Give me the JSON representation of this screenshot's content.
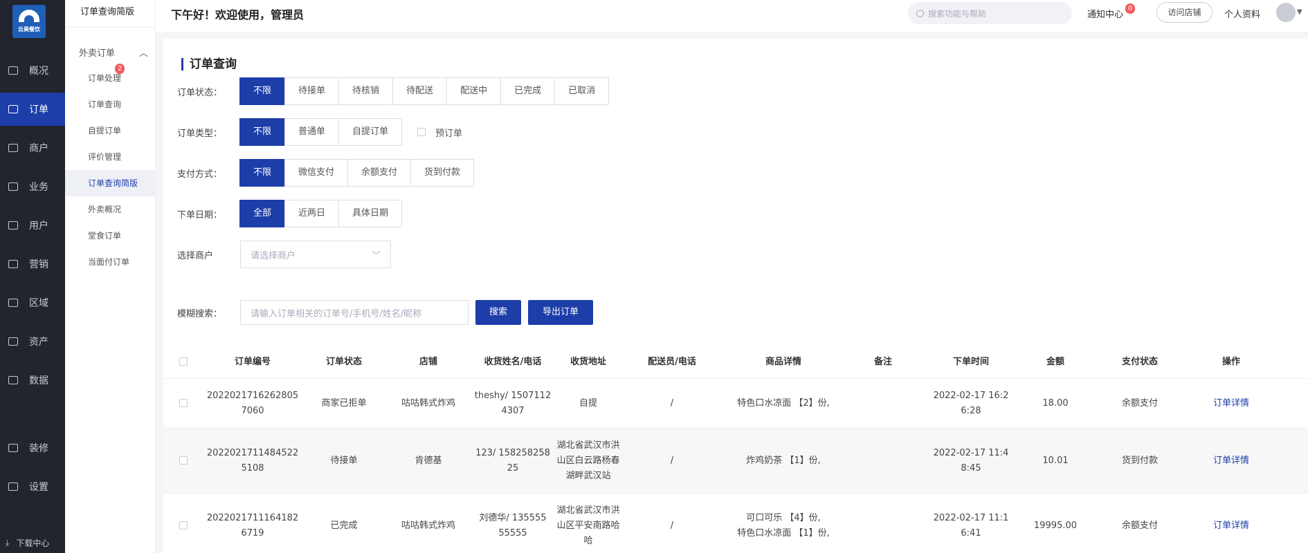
{
  "brand": {
    "logo_text": "云昊餐饮"
  },
  "nav": {
    "items": [
      {
        "label": "概况"
      },
      {
        "label": "订单"
      },
      {
        "label": "商户"
      },
      {
        "label": "业务"
      },
      {
        "label": "用户"
      },
      {
        "label": "营销"
      },
      {
        "label": "区域"
      },
      {
        "label": "资产"
      },
      {
        "label": "数据"
      },
      {
        "label": "装修"
      },
      {
        "label": "设置"
      }
    ],
    "download": "下载中心"
  },
  "subnav": {
    "title": "订单查询简版",
    "group": "外卖订单",
    "badge": "2",
    "items": [
      {
        "label": "订单处理"
      },
      {
        "label": "订单查询"
      },
      {
        "label": "自提订单"
      },
      {
        "label": "评价管理"
      },
      {
        "label": "订单查询简版"
      },
      {
        "label": "外卖概况"
      },
      {
        "label": "堂食订单"
      },
      {
        "label": "当面付订单"
      }
    ]
  },
  "header": {
    "greeting": "下午好！欢迎使用，管理员",
    "search_placeholder": "搜索功能与帮助",
    "notify": "通知中心",
    "notify_count": "0",
    "visit": "访问店铺",
    "profile": "个人资料"
  },
  "filters": {
    "title": "订单查询",
    "status": {
      "label": "订单状态：",
      "options": [
        "不限",
        "待接单",
        "待核销",
        "待配送",
        "配送中",
        "已完成",
        "已取消"
      ]
    },
    "type": {
      "label": "订单类型：",
      "options": [
        "不限",
        "普通单",
        "自提订单"
      ],
      "preorder": "预订单"
    },
    "pay": {
      "label": "支付方式：",
      "options": [
        "不限",
        "微信支付",
        "余额支付",
        "货到付款"
      ]
    },
    "date": {
      "label": "下单日期：",
      "options": [
        "全部",
        "近两日",
        "具体日期"
      ]
    },
    "merchant": {
      "label": "选择商户",
      "placeholder": "请选择商户"
    },
    "fuzzy": {
      "label": "模糊搜索：",
      "placeholder": "请输入订单相关的订单号/手机号/姓名/昵称",
      "search": "搜索",
      "export": "导出订单"
    }
  },
  "table": {
    "headers": [
      "订单编号",
      "订单状态",
      "店铺",
      "收货姓名/电话",
      "收货地址",
      "配送员/电话",
      "商品详情",
      "备注",
      "下单时间",
      "金额",
      "支付状态",
      "操作"
    ],
    "rows": [
      {
        "id1": "2022021716262805",
        "id2": "7060",
        "status": "商家已拒单",
        "shop": "咕咕韩式炸鸡",
        "contact1": "theshy/ 1507112",
        "contact2": "4307",
        "addr1": "自提",
        "addr2": "",
        "addr3": "",
        "courier": "/",
        "goods1": "特色口水凉面 【2】份,",
        "goods2": "",
        "note": "",
        "time1": "2022-02-17 16:2",
        "time2": "6:28",
        "amount": "18.00",
        "pay": "余额支付",
        "action": "订单详情"
      },
      {
        "id1": "2022021711484522",
        "id2": "5108",
        "status": "待接单",
        "shop": "肯德基",
        "contact1": "123/ 158258258",
        "contact2": "25",
        "addr1": "湖北省武汉市洪",
        "addr2": "山区白云路杨春",
        "addr3": "湖畔武汉站",
        "courier": "/",
        "goods1": "炸鸡奶茶 【1】份,",
        "goods2": "",
        "note": "",
        "time1": "2022-02-17 11:4",
        "time2": "8:45",
        "amount": "10.01",
        "pay": "货到付款",
        "action": "订单详情"
      },
      {
        "id1": "2022021711164182",
        "id2": "6719",
        "status": "已完成",
        "shop": "咕咕韩式炸鸡",
        "contact1": "刘德华/ 135555",
        "contact2": "55555",
        "addr1": "湖北省武汉市洪",
        "addr2": "山区平安南路哈",
        "addr3": "哈",
        "courier": "/",
        "goods1": "可口可乐 【4】份,",
        "goods2": "特色口水凉面 【1】份,",
        "note": "",
        "time1": "2022-02-17 11:1",
        "time2": "6:41",
        "amount": "19995.00",
        "pay": "余额支付",
        "action": "订单详情"
      }
    ]
  },
  "colors": {
    "accent": "#1d3ea8",
    "sidebar": "#22252d",
    "badge": "#f45a5a"
  }
}
